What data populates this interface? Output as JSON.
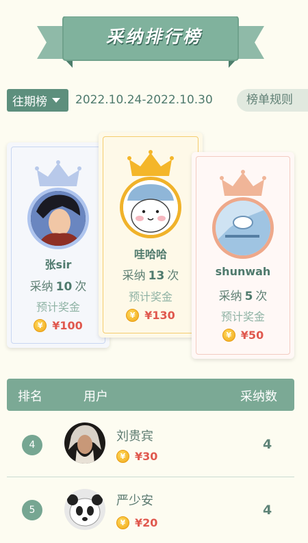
{
  "banner": {
    "title": "采纳排行榜"
  },
  "filter": {
    "period_label": "往期榜",
    "date_range": "2022.10.24-2022.10.30",
    "rules_label": "榜单规则"
  },
  "podium": {
    "second": {
      "name": "张sir",
      "count_prefix": "采纳",
      "count": "10",
      "count_suffix": "次",
      "bonus_label": "预计奖金",
      "prize": "¥100"
    },
    "first": {
      "name": "哇哈哈",
      "count_prefix": "采纳",
      "count": "13",
      "count_suffix": "次",
      "bonus_label": "预计奖金",
      "prize": "¥130"
    },
    "third": {
      "name": "shunwah",
      "count_prefix": "采纳",
      "count": "5",
      "count_suffix": "次",
      "bonus_label": "预计奖金",
      "prize": "¥50"
    }
  },
  "table": {
    "headers": {
      "rank": "排名",
      "user": "用户",
      "count": "采纳数"
    },
    "rows": [
      {
        "rank": "4",
        "name": "刘贵宾",
        "prize": "¥30",
        "count": "4"
      },
      {
        "rank": "5",
        "name": "严少安",
        "prize": "¥20",
        "count": "4"
      }
    ]
  },
  "colors": {
    "accent": "#7ba995",
    "prize": "#e0584e",
    "gold": "#f4b62a",
    "silver": "#b8c9ea",
    "bronze": "#f0b598"
  },
  "icons": {
    "coin": "coin-icon",
    "crown": "crown-icon",
    "caret": "caret-down-icon"
  }
}
